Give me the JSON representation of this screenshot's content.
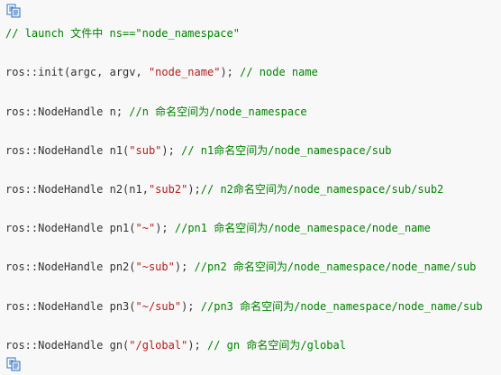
{
  "colors": {
    "background": "#f8f8f8",
    "code_text": "#333333",
    "comment": "#008200",
    "string": "#b41c1c",
    "icon_blue": "#2f6fbf"
  },
  "icons": {
    "top": "copy-code-icon",
    "bottom": "copy-code-icon"
  },
  "lines": [
    {
      "code": "",
      "str": "",
      "code2": "",
      "comment": "// launch 文件中 ns==\"node_namespace\""
    },
    {
      "code": "ros::init(argc, argv, ",
      "str": "\"node_name\"",
      "code2": "); ",
      "comment": "// node name"
    },
    {
      "code": "ros::NodeHandle n; ",
      "str": "",
      "code2": "",
      "comment": "//n 命名空间为/node_namespace"
    },
    {
      "code": "ros::NodeHandle n1(",
      "str": "\"sub\"",
      "code2": "); ",
      "comment": "// n1命名空间为/node_namespace/sub"
    },
    {
      "code": "ros::NodeHandle n2(n1,",
      "str": "\"sub2\"",
      "code2": ");",
      "comment": "// n2命名空间为/node_namespace/sub/sub2"
    },
    {
      "code": "ros::NodeHandle pn1(",
      "str": "\"~\"",
      "code2": "); ",
      "comment": "//pn1 命名空间为/node_namespace/node_name"
    },
    {
      "code": "ros::NodeHandle pn2(",
      "str": "\"~sub\"",
      "code2": "); ",
      "comment": "//pn2 命名空间为/node_namespace/node_name/sub"
    },
    {
      "code": "ros::NodeHandle pn3(",
      "str": "\"~/sub\"",
      "code2": "); ",
      "comment": "//pn3 命名空间为/node_namespace/node_name/sub"
    },
    {
      "code": "ros::NodeHandle gn(",
      "str": "\"/global\"",
      "code2": "); ",
      "comment": "// gn 命名空间为/global"
    }
  ]
}
